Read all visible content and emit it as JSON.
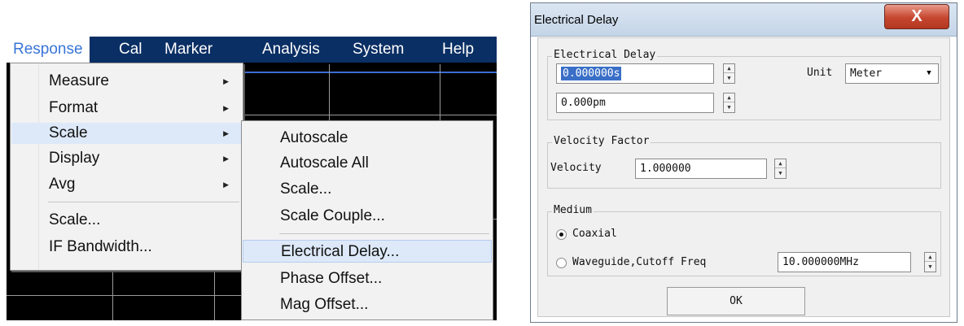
{
  "menu": {
    "menubar": [
      "Response",
      "Cal",
      "Marker",
      "Analysis",
      "System",
      "Help"
    ],
    "active_menu": "Response",
    "response_items": [
      "Measure",
      "Format",
      "Scale",
      "Display",
      "Avg",
      "Scale...",
      "IF Bandwidth..."
    ],
    "highlighted_item": "Scale",
    "scale_submenu": [
      "Autoscale",
      "Autoscale All",
      "Scale...",
      "Scale Couple...",
      "Electrical Delay...",
      "Phase Offset...",
      "Mag Offset..."
    ],
    "highlighted_submenu_item": "Electrical Delay..."
  },
  "dialog": {
    "title": "Electrical Delay",
    "close_label": "X",
    "electrical_delay": {
      "group_title": "Electrical Delay",
      "time_value": "0.000000s",
      "distance_value": "0.000pm",
      "unit_label": "Unit",
      "unit_value": "Meter"
    },
    "velocity": {
      "group_title": "Velocity Factor",
      "label": "Velocity",
      "value": "1.000000"
    },
    "medium": {
      "group_title": "Medium",
      "coaxial_label": "Coaxial",
      "waveguide_label": "Waveguide,Cutoff Freq",
      "cutoff_value": "10.000000MHz",
      "selected": "Coaxial"
    },
    "ok_label": "OK"
  },
  "colors": {
    "menubar_bg": "#0a2f64",
    "active_menu_text": "#3875d6",
    "menu_highlight": "#dde9f8",
    "selection_bg": "#3a6fc7",
    "close_button": "#c6462f"
  }
}
